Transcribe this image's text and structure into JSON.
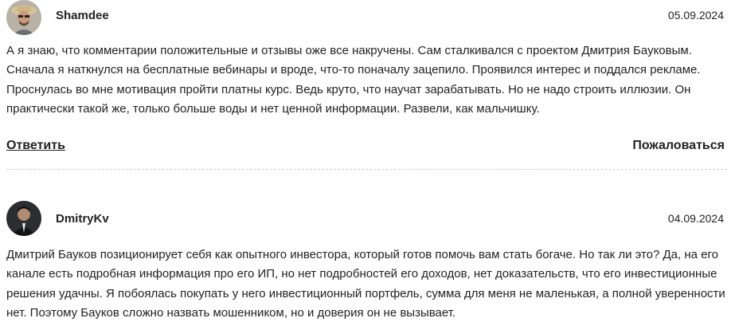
{
  "comments": [
    {
      "author": "Shamdee",
      "date": "05.09.2024",
      "avatar_icon": "user-avatar-photo",
      "text": "А я знаю, что комментарии положительные и отзывы оже все накручены. Сам сталкивался с проектом Дмитрия Бауковым. Сначала я наткнулся на бесплатные вебинары и вроде, что-то поначалу зацепило. Проявился интерес и поддался рекламе. Проснулась во мне мотивация пройти платны курс. Ведь круто, что научат зарабатывать. Но не надо строить иллюзии. Он практически такой же, только больше воды и нет ценной информации. Развели, как мальчишку.",
      "reply_label": "Ответить",
      "report_label": "Пожаловаться"
    },
    {
      "author": "DmitryKv",
      "date": "04.09.2024",
      "avatar_icon": "user-avatar-photo",
      "text": "Дмитрий Бауков позиционирует себя как опытного инвестора, который готов помочь вам стать богаче. Но так ли это? Да, на его канале есть подробная информация про его ИП, но нет подробностей его доходов, нет доказательств, что его инвестиционные решения удачны. Я побоялась покупать у него инвестиционный портфель, сумма для меня не маленькая, а полной уверенности нет. Поэтому Бауков сложно назвать мошенником, но и доверия он не вызывает."
    }
  ],
  "colors": {
    "text": "#222222",
    "divider": "#cfcfcf",
    "background": "#ffffff"
  }
}
